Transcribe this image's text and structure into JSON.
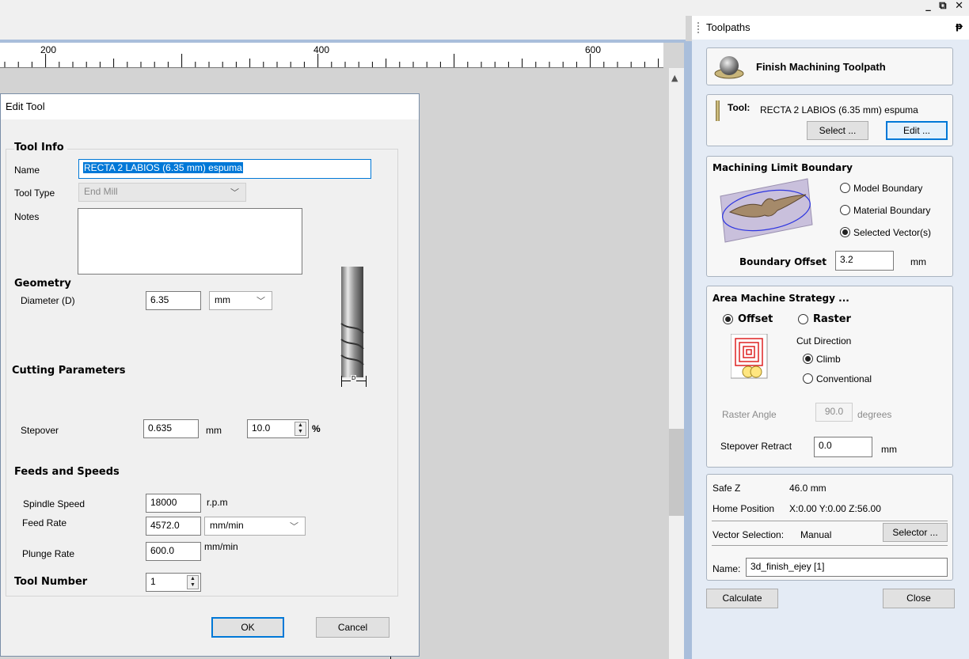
{
  "window": {
    "controls": "_ ⧉ ✕"
  },
  "ruler": {
    "labels": [
      "200",
      "400",
      "600"
    ]
  },
  "edit_tool": {
    "title": "Edit Tool",
    "tool_info": {
      "header": "Tool Info",
      "name_label": "Name",
      "name_value": "RECTA 2 LABIOS (6.35 mm) espuma",
      "tool_type_label": "Tool Type",
      "tool_type_value": "End Mill",
      "notes_label": "Notes",
      "notes_value": ""
    },
    "geometry": {
      "header": "Geometry",
      "diameter_label": "Diameter (D)",
      "diameter_value": "6.35",
      "unit_value": "mm",
      "diagram_label": "D"
    },
    "cutting": {
      "header": "Cutting Parameters",
      "stepover_label": "Stepover",
      "stepover_value": "0.635",
      "stepover_unit": "mm",
      "stepover_percent": "10.0",
      "percent_sign": "%"
    },
    "feeds": {
      "header": "Feeds and Speeds",
      "spindle_label": "Spindle Speed",
      "spindle_value": "18000",
      "spindle_unit": "r.p.m",
      "feed_label": "Feed Rate",
      "feed_value": "4572.0",
      "feed_unit": "mm/min",
      "plunge_label": "Plunge Rate",
      "plunge_value": "600.0",
      "plunge_unit": "mm/min"
    },
    "tool_number": {
      "header": "Tool Number",
      "value": "1"
    },
    "buttons": {
      "ok": "OK",
      "cancel": "Cancel"
    }
  },
  "toolpaths": {
    "panel_title": "Toolpaths",
    "pin": "ᵽ",
    "heading": "Finish Machining Toolpath",
    "tool": {
      "label": "Tool:",
      "value": "RECTA 2 LABIOS (6.35 mm) espuma",
      "select_button": "Select ...",
      "edit_button": "Edit ..."
    },
    "boundary": {
      "header": "Machining Limit Boundary",
      "options": [
        "Model Boundary",
        "Material Boundary",
        "Selected Vector(s)"
      ],
      "selected": "Selected Vector(s)",
      "offset_label": "Boundary Offset",
      "offset_value": "3.2",
      "offset_unit": "mm"
    },
    "strategy": {
      "header": "Area Machine Strategy ...",
      "offset_label": "Offset",
      "raster_label": "Raster",
      "cut_direction_label": "Cut Direction",
      "climb_label": "Climb",
      "conventional_label": "Conventional",
      "raster_angle_label": "Raster Angle",
      "raster_angle_value": "90.0",
      "raster_angle_unit": "degrees",
      "stepover_retract_label": "Stepover Retract",
      "stepover_retract_value": "0.0",
      "stepover_retract_unit": "mm"
    },
    "info": {
      "safe_z_label": "Safe Z",
      "safe_z_value": "46.0 mm",
      "home_label": "Home Position",
      "home_value": "X:0.00 Y:0.00 Z:56.00",
      "vector_selection_label": "Vector Selection:",
      "vector_selection_value": "Manual",
      "selector_button": "Selector ...",
      "name_label": "Name:",
      "name_value": "3d_finish_ejey [1]"
    },
    "calculate_button": "Calculate",
    "close_button": "Close"
  }
}
